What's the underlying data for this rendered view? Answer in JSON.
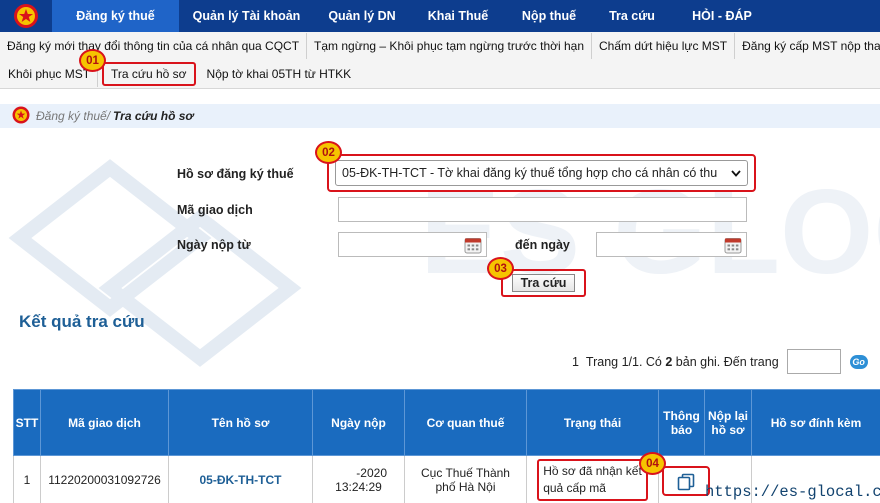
{
  "nav": {
    "items": [
      "Đăng ký thuế",
      "Quản lý Tài khoản",
      "Quản lý DN",
      "Khai Thuế",
      "Nộp thuế",
      "Tra cứu",
      "HỎI - ĐÁP"
    ],
    "active_index": 0
  },
  "submenu": {
    "row1": [
      "Đăng ký mới thay đổi thông tin của cá nhân qua CQCT",
      "Tạm ngừng – Khôi phục tạm ngừng trước thời hạn",
      "Chấm dứt hiệu lực MST",
      "Đăng ký cấp MST nộp thay"
    ],
    "row2": [
      "Khôi phục MST",
      "Tra cứu hồ sơ",
      "Nộp tờ khai 05TH từ HTKK"
    ]
  },
  "breadcrumb": {
    "parent": "Đăng ký thuế/",
    "current": "Tra cứu hồ sơ"
  },
  "form": {
    "ho_so_label": "Hồ sơ đăng ký thuế",
    "ho_so_value": "05-ĐK-TH-TCT - Tờ khai đăng ký thuế tổng hợp cho cá nhân có thu",
    "ma_gd_label": "Mã giao dịch",
    "ma_gd_value": "",
    "ngay_nop_tu_label": "Ngày nộp từ",
    "den_ngay_label": "đến ngày",
    "search_button": "Tra cứu"
  },
  "steps": [
    "01",
    "02",
    "03",
    "04"
  ],
  "results": {
    "title": "Kết quả tra cứu",
    "pager": {
      "page_num": "1",
      "text_prefix": "Trang 1/1. Có",
      "count": "2",
      "text_suffix": "bản ghi. Đến trang",
      "go_label": "Go"
    },
    "columns": [
      "STT",
      "Mã giao dịch",
      "Tên hồ sơ",
      "Ngày nộp",
      "Cơ quan thuế",
      "Trạng thái",
      "Thông báo",
      "Nộp lại hồ sơ",
      "Hồ sơ đính kèm"
    ],
    "rows": [
      {
        "stt": "1",
        "ma_gd": "11220200031092726",
        "ten_ho_so": "05-ĐK-TH-TCT",
        "ngay_nop_date": "-2020",
        "ngay_nop_time": "13:24:29",
        "co_quan_line1": "Cục Thuế Thành",
        "co_quan_line2": "phố Hà Nội",
        "trang_thai_line1": "Hồ sơ đã nhận kết",
        "trang_thai_line2": "quả cấp mã"
      }
    ]
  },
  "watermark_text": "ES GLOCAL",
  "footer_url": "https://es-glocal.com/",
  "colors": {
    "nav_bg": "#0d3d8e",
    "nav_active": "#1f64c8",
    "table_header": "#1a6bbf",
    "highlight": "#d9131b",
    "badge": "#f6c400",
    "title_blue": "#1e5f96"
  },
  "icons": {
    "home": "vn-emblem-icon",
    "breadcrumb": "emblem-icon",
    "calendar": "calendar-icon",
    "notice": "document-copy-icon"
  }
}
